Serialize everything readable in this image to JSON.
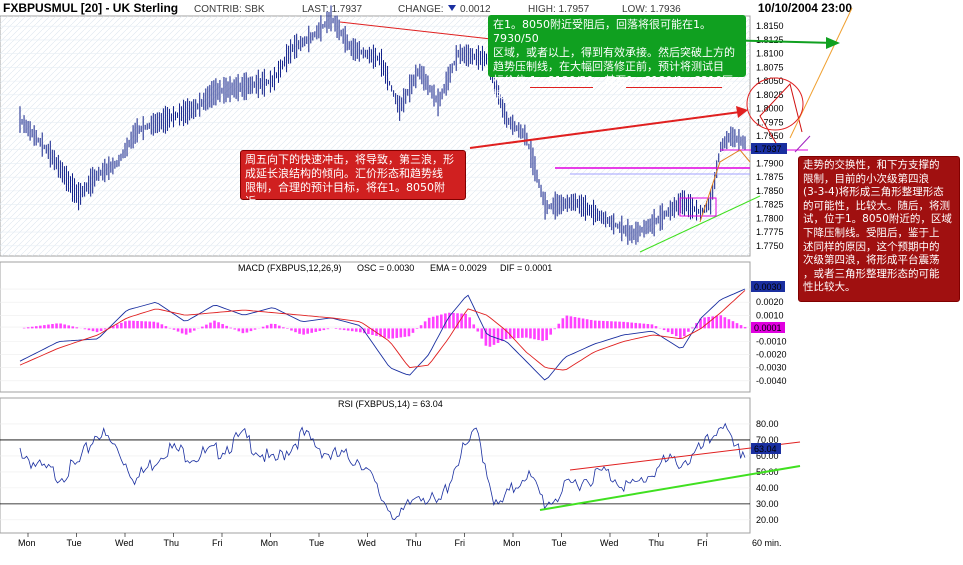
{
  "header": {
    "symbol": "FXBPUSMUL [20] - UK Sterling",
    "contrib": "CONTRIB: SBK",
    "last": "LAST: 1.7937",
    "change_label": "CHANGE:",
    "change_value": "0.0012",
    "high": "HIGH: 1.7957",
    "low": "LOW: 1.7936",
    "datetime": "10/10/2004 23:00"
  },
  "price": {
    "ticks": [
      "1.8150",
      "1.8125",
      "1.8100",
      "1.8075",
      "1.8050",
      "1.8025",
      "1.8000",
      "1.7975",
      "1.7950",
      "1.7925",
      "1.7900",
      "1.7875",
      "1.7850",
      "1.7825",
      "1.7800",
      "1.7775",
      "1.7750"
    ],
    "tick_values": [
      1.815,
      1.8125,
      1.81,
      1.8075,
      1.805,
      1.8025,
      1.8,
      1.7975,
      1.795,
      1.7925,
      1.79,
      1.7875,
      1.785,
      1.7825,
      1.78,
      1.7775,
      1.775
    ],
    "last_tag": "1.7937",
    "ylim": [
      1.7735,
      1.8165
    ]
  },
  "macd": {
    "title": "MACD (FXBPUS,12,26,9)",
    "osc": "OSC = 0.0030",
    "ema": "EMA = 0.0029",
    "dif": "DIF = 0.0001",
    "ticks": [
      "0.0030",
      "0.0020",
      "0.0010",
      "0.0001",
      "-0.0010",
      "-0.0020",
      "-0.0030",
      "-0.0040"
    ],
    "tick_values": [
      0.003,
      0.002,
      0.001,
      0.0001,
      -0.001,
      -0.002,
      -0.003,
      -0.004
    ],
    "tag_osc": "0.0030",
    "tag_dif": "0.0001",
    "ylim": [
      -0.0047,
      0.0043
    ]
  },
  "rsi": {
    "title": "RSI (FXBPUS,14) = 63.04",
    "ticks": [
      "80.00",
      "70.00",
      "60.00",
      "50.00",
      "40.00",
      "30.00",
      "20.00"
    ],
    "tick_values": [
      80,
      70,
      60,
      50,
      40,
      30,
      20
    ],
    "tag": "63.04",
    "ylim": [
      13,
      90
    ]
  },
  "days": [
    "Mon",
    "Tue",
    "Wed",
    "Thu",
    "Fri",
    "Mon",
    "Tue",
    "Wed",
    "Thu",
    "Fri",
    "Mon",
    "Tue",
    "Wed",
    "Thu",
    "Fri"
  ],
  "interval": "60 min.",
  "notes": {
    "green_l1": "在1。8050附近受阻后，回落将很可能在1。7930/50",
    "green_l2": "区域，或者以上，得到有效承接。然后突破上方的",
    "green_l3": "趋势压制线，在大幅回落修正前，预计将测试目",
    "green_l4_a": "标价位:",
    "green_l4_b": "1。8130/50",
    "green_l4_c": "；甚至",
    "green_l4_d": "1。8180/1。8210",
    "green_l4_e": "区域。",
    "red_l1": "周五向下的快速冲击，将导致，第三浪，形",
    "red_l2": "成延长浪结构的倾向。汇价形态和趋势线",
    "red_l3": "限制，合理的预计目标，将在1。8050附近。",
    "right_l1": "走势的交换性，和下方支撑的",
    "right_l2": "限制，目前的小次级第四浪",
    "right_l3": "(3-3-4)将形成三角形整理形态",
    "right_l4": "的可能性，比较大。随后，将测",
    "right_l5": "试，位于1。8050附近的，区域",
    "right_l6": "下降压制线。受阻后，鉴于上",
    "right_l7": "述同样的原因，这个预期中的",
    "right_l8": "次级第四浪，将形成平台震荡",
    "right_l9": "，或者三角形整理形态的可能",
    "right_l10": "性比较大。"
  },
  "chart_data": [
    {
      "type": "line",
      "title": "FXBPUSMUL [20] - UK Sterling",
      "ylim": [
        1.7735,
        1.8165
      ],
      "x": [
        0,
        30,
        60,
        80,
        100,
        120,
        150,
        180,
        200,
        230,
        260,
        280,
        300,
        320,
        340,
        370,
        390,
        410,
        430,
        450,
        480,
        500,
        520,
        540,
        570,
        600,
        630,
        650,
        680,
        700,
        710,
        720,
        730,
        745
      ],
      "series": [
        {
          "name": "",
          "values": [
            1.798,
            1.792,
            1.784,
            1.788,
            1.79,
            1.796,
            1.798,
            1.8,
            1.803,
            1.804,
            1.805,
            1.811,
            1.813,
            1.8165,
            1.811,
            1.809,
            1.8,
            1.807,
            1.801,
            1.81,
            1.809,
            1.798,
            1.795,
            1.782,
            1.783,
            1.78,
            1.777,
            1.779,
            1.783,
            1.781,
            1.783,
            1.793,
            1.795,
            1.7937
          ]
        }
      ]
    },
    {
      "type": "line",
      "title": "MACD (FXBPUS,12,26,9)",
      "ylim": [
        -0.0047,
        0.0043
      ],
      "x": [
        0,
        40,
        80,
        110,
        140,
        170,
        200,
        230,
        260,
        290,
        320,
        350,
        380,
        400,
        420,
        440,
        460,
        480,
        500,
        520,
        540,
        560,
        590,
        620,
        650,
        680,
        700,
        720,
        745
      ],
      "series": [
        {
          "name": "OSC",
          "values": [
            -0.0025,
            -0.001,
            -0.0008,
            0.0014,
            0.002,
            0.0005,
            0.0018,
            0.001,
            0.0016,
            0.0005,
            0.0008,
            0.0002,
            -0.003,
            -0.0036,
            -0.002,
            0.0008,
            0.0026,
            -0.0005,
            -0.001,
            -0.0025,
            -0.004,
            -0.0022,
            -0.0012,
            -0.0005,
            -0.0002,
            -0.0016,
            0.0008,
            0.0022,
            0.003
          ]
        },
        {
          "name": "EMA",
          "values": [
            -0.0028,
            -0.0015,
            -0.0005,
            0.0008,
            0.0015,
            0.001,
            0.0012,
            0.0014,
            0.0012,
            0.001,
            0.0008,
            0.0005,
            -0.001,
            -0.003,
            -0.0028,
            -0.0008,
            0.0015,
            0.001,
            -0.0002,
            -0.0018,
            -0.003,
            -0.0032,
            -0.0018,
            -0.001,
            -0.0005,
            -0.0008,
            0.0,
            0.0012,
            0.0029
          ]
        },
        {
          "name": "DIF",
          "values": [
            0.0,
            0.0004,
            -0.0003,
            0.0006,
            0.0005,
            -0.0005,
            0.0006,
            -0.0004,
            0.0004,
            -0.0005,
            0.0,
            -0.0003,
            -0.0008,
            -0.0006,
            0.0008,
            0.0012,
            0.0011,
            -0.0015,
            -0.0008,
            -0.0007,
            -0.001,
            0.001,
            0.0006,
            0.0005,
            0.0003,
            -0.0008,
            0.0008,
            0.001,
            0.0001
          ]
        }
      ]
    },
    {
      "type": "line",
      "title": "RSI (FXBPUS,14) = 63.04",
      "ylim": [
        13,
        90
      ],
      "x": [
        0,
        20,
        40,
        60,
        80,
        100,
        120,
        150,
        180,
        200,
        230,
        260,
        290,
        320,
        350,
        370,
        390,
        410,
        430,
        450,
        470,
        490,
        520,
        540,
        570,
        600,
        630,
        660,
        690,
        710,
        720,
        735,
        745
      ],
      "series": [
        {
          "name": "",
          "values": [
            64,
            52,
            48,
            54,
            76,
            64,
            45,
            65,
            60,
            62,
            72,
            55,
            73,
            60,
            58,
            35,
            20,
            38,
            28,
            58,
            75,
            26,
            50,
            30,
            43,
            50,
            40,
            55,
            58,
            70,
            82,
            62,
            63
          ]
        }
      ]
    }
  ]
}
